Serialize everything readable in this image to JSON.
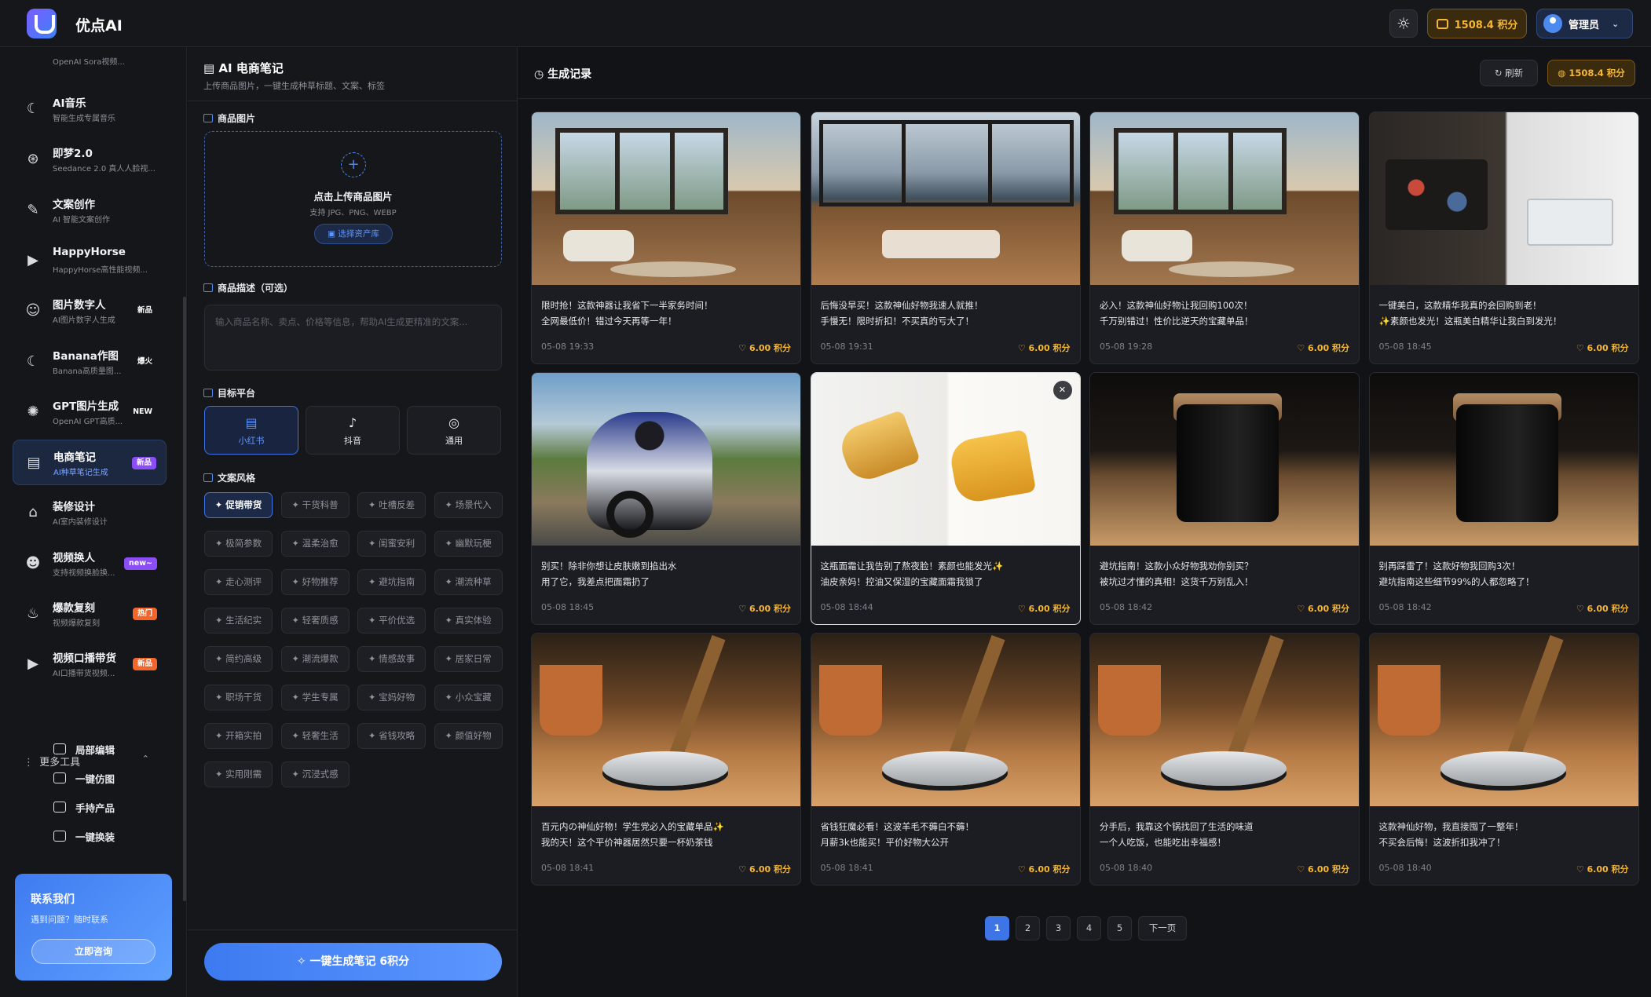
{
  "app": {
    "brand": "优点AI",
    "points_label": "1508.4 积分",
    "user_label": "管理员"
  },
  "sidebar": {
    "cut_item": {
      "sub": "OpenAI Sora视频..."
    },
    "items": [
      {
        "title": "AI音乐",
        "sub": "智能生成专属音乐",
        "badge": "",
        "icon": "banana-icon"
      },
      {
        "title": "即梦2.0",
        "sub": "Seedance 2.0 真人人脸视...",
        "badge": "",
        "icon": "aperture-icon"
      },
      {
        "title": "文案创作",
        "sub": "AI 智能文案创作",
        "badge": "",
        "icon": "pen-icon"
      },
      {
        "title": "HappyHorse",
        "sub": "HappyHorse高性能视频...",
        "badge": "",
        "icon": "video-icon"
      },
      {
        "title": "图片数字人",
        "sub": "AI图片数字人生成",
        "badge": "新品",
        "icon": "user-voice-icon"
      },
      {
        "title": "Banana作图",
        "sub": "Banana高质量图...",
        "badge": "爆火",
        "icon": "banana-icon"
      },
      {
        "title": "GPT图片生成",
        "sub": "OpenAI GPT高质...",
        "badge": "NEW",
        "icon": "openai-icon"
      },
      {
        "title": "电商笔记",
        "sub": "AI种草笔记生成",
        "badge": "新品",
        "icon": "note-icon"
      },
      {
        "title": "装修设计",
        "sub": "AI室内装修设计",
        "badge": "",
        "icon": "home-icon"
      },
      {
        "title": "视频换人",
        "sub": "支持视频换脸换...",
        "badge": "new~",
        "icon": "face-swap-icon"
      },
      {
        "title": "爆款复刻",
        "sub": "视频爆款复刻",
        "badge": "热门",
        "icon": "fire-icon"
      },
      {
        "title": "视频口播带货",
        "sub": "AI口播带货视频...",
        "badge": "新品",
        "icon": "video-icon"
      }
    ],
    "more_tools": "更多工具",
    "sub_tools": [
      "局部编辑",
      "一键仿图",
      "手持产品",
      "一键换装"
    ],
    "contact": {
      "title": "联系我们",
      "sub": "遇到问题？随时联系",
      "button": "立即咨询"
    }
  },
  "form": {
    "title": "AI 电商笔记",
    "subtitle": "上传商品图片，一键生成种草标题、文案、标签",
    "image_label": "商品图片",
    "upload_title": "点击上传商品图片",
    "upload_hint": "支持 JPG、PNG、WEBP",
    "upload_button": "选择资产库",
    "desc_label": "商品描述（可选）",
    "desc_placeholder": "输入商品名称、卖点、价格等信息，帮助AI生成更精准的文案...",
    "platform_label": "目标平台",
    "platforms": [
      "小红书",
      "抖音",
      "通用"
    ],
    "style_label": "文案风格",
    "styles": [
      "✦ 促销带货",
      "✦ 干货科普",
      "✦ 吐槽反差",
      "✦ 场景代入",
      "✦ 极简参数",
      "✦ 温柔治愈",
      "✦ 闺蜜安利",
      "✦ 幽默玩梗",
      "✦ 走心测评",
      "✦ 好物推荐",
      "✦ 避坑指南",
      "✦ 潮流种草",
      "✦ 生活纪实",
      "✦ 轻奢质感",
      "✦ 平价优选",
      "✦ 真实体验",
      "✦ 简约高级",
      "✦ 潮流爆款",
      "✦ 情感故事",
      "✦ 居家日常",
      "✦ 职场干货",
      "✦ 学生专属",
      "✦ 宝妈好物",
      "✦ 小众宝藏",
      "✦ 开箱实拍",
      "✦ 轻奢生活",
      "✦ 省钱攻略",
      "✦ 颜值好物",
      "✦ 实用刚需",
      "✦ 沉浸式感"
    ],
    "generate_button": "一键生成笔记  6积分"
  },
  "results": {
    "title": "生成记录",
    "refresh": "刷新",
    "points": "1508.4 积分",
    "cards": [
      {
        "l1": "限时抢！这款神器让我省下一半家务时间！",
        "l2": "全网最低价！错过今天再等一年！",
        "time": "05-08 19:33",
        "cost": "6.00 积分",
        "scene": "house"
      },
      {
        "l1": "后悔没早买！这款神仙好物我速人就推！",
        "l2": "手慢无！限时折扣！不买真的亏大了！",
        "time": "05-08 19:31",
        "cost": "6.00 积分",
        "scene": "lake"
      },
      {
        "l1": "必入！这款神仙好物让我回购100次！",
        "l2": "千万别错过！性价比逆天的宝藏单品！",
        "time": "05-08 19:28",
        "cost": "6.00 积分",
        "scene": "house"
      },
      {
        "l1": "一键美白，这款精华我真的会回购到老！",
        "l2": "✨素颜也发光！这瓶美白精华让我白到发光！",
        "time": "05-08 18:45",
        "cost": "6.00 积分",
        "scene": "kitchen"
      },
      {
        "l1": "别买！除非你想让皮肤嫩到掐出水",
        "l2": "用了它，我差点把面霜扔了",
        "time": "05-08 18:45",
        "cost": "6.00 积分",
        "scene": "moto"
      },
      {
        "l1": "这瓶面霜让我告别了熬夜脸！素颜也能发光✨",
        "l2": "油皮亲妈！控油又保湿的宝藏面霜我锁了",
        "time": "05-08 18:44",
        "cost": "6.00 积分",
        "scene": "serum"
      },
      {
        "l1": "避坑指南！这款小众好物我劝你别买？",
        "l2": "被坑过才懂的真相！这货千万别乱入！",
        "time": "05-08 18:42",
        "cost": "6.00 积分",
        "scene": "jar"
      },
      {
        "l1": "别再踩雷了！这款好物我回购3次！",
        "l2": "避坑指南这些细节99%的人都忽略了！",
        "time": "05-08 18:42",
        "cost": "6.00 积分",
        "scene": "jar"
      },
      {
        "l1": "百元内の神仙好物！学生党必入的宝藏单品✨",
        "l2": "我的天！这个平价神器居然只要一杯奶茶钱",
        "time": "05-08 18:41",
        "cost": "6.00 积分",
        "scene": "robot"
      },
      {
        "l1": "省钱狂魔必看！这波羊毛不薅白不薅！",
        "l2": "月薪3k也能买！平价好物大公开",
        "time": "05-08 18:41",
        "cost": "6.00 积分",
        "scene": "robot"
      },
      {
        "l1": "分手后，我靠这个锅找回了生活的味道",
        "l2": "一个人吃饭，也能吃出幸福感！",
        "time": "05-08 18:40",
        "cost": "6.00 积分",
        "scene": "robot"
      },
      {
        "l1": "这款神仙好物，我直接囤了一整年！",
        "l2": "不买会后悔！这波折扣我冲了！",
        "time": "05-08 18:40",
        "cost": "6.00 积分",
        "scene": "robot"
      }
    ],
    "pagination": [
      "1",
      "2",
      "3",
      "4",
      "5"
    ],
    "next_label": "下一页"
  }
}
